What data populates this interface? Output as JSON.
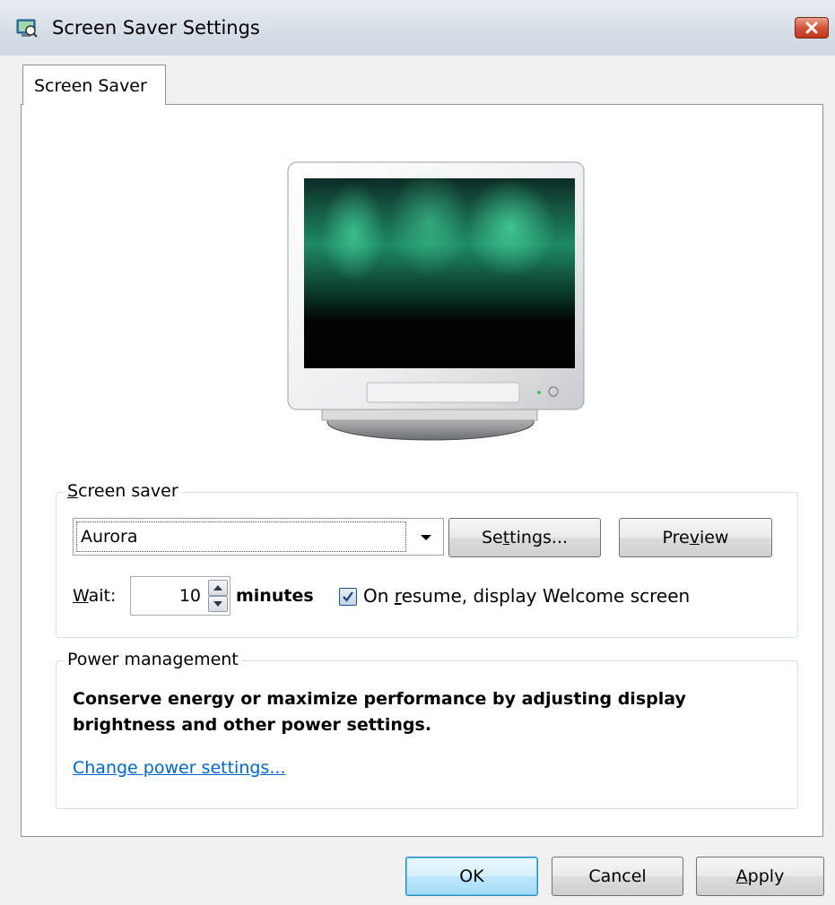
{
  "window": {
    "title": "Screen Saver Settings",
    "close_icon": "close-icon",
    "app_icon": "screen-saver-app-icon"
  },
  "tabs": [
    {
      "label": "Screen Saver",
      "selected": true
    }
  ],
  "preview": {
    "monitor_icon": "crt-monitor-preview",
    "screen_image": "aurora-preview"
  },
  "screen_saver_group": {
    "legend_accel": "S",
    "legend_rest": "creen saver",
    "selected_saver": "Aurora",
    "settings_button": {
      "before": "Se",
      "accel": "t",
      "after": "tings..."
    },
    "preview_button": {
      "before": "Pre",
      "accel": "v",
      "after": "iew"
    },
    "wait_accel": "W",
    "wait_rest": "ait:",
    "wait_value": "10",
    "minutes_label": "minutes",
    "resume_checked": true,
    "resume_label_before": "On ",
    "resume_label_accel": "r",
    "resume_label_after": "esume, display Welcome screen"
  },
  "power_group": {
    "legend": "Power management",
    "description": "Conserve energy or maximize performance by adjusting display brightness and other power settings.",
    "link": "Change power settings..."
  },
  "footer": {
    "ok": "OK",
    "cancel": "Cancel",
    "apply_accel": "A",
    "apply_rest": "pply"
  },
  "colors": {
    "link": "#0066cc",
    "close_button": "#c4361b",
    "default_button_border": "#3c7fb1"
  }
}
